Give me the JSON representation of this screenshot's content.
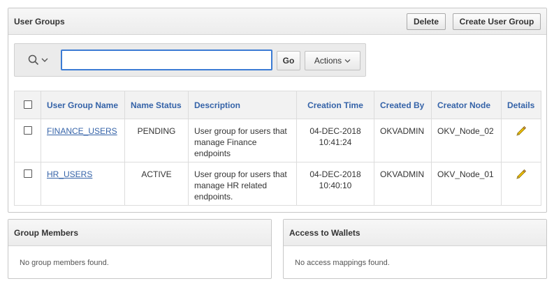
{
  "user_groups": {
    "title": "User Groups",
    "delete_label": "Delete",
    "create_label": "Create User Group",
    "search": {
      "value": "",
      "go_label": "Go",
      "actions_label": "Actions"
    },
    "columns": [
      "User Group Name",
      "Name Status",
      "Description",
      "Creation Time",
      "Created By",
      "Creator Node",
      "Details"
    ],
    "rows": [
      {
        "name": "FINANCE_USERS",
        "status": "PENDING",
        "description": "User group for users that manage Finance endpoints",
        "date": "04-DEC-2018",
        "time": "10:41:24",
        "created_by": "OKVADMIN",
        "creator_node": "OKV_Node_02"
      },
      {
        "name": "HR_USERS",
        "status": "ACTIVE",
        "description": "User group for users that manage HR related endpoints.",
        "date": "04-DEC-2018",
        "time": "10:40:10",
        "created_by": "OKVADMIN",
        "creator_node": "OKV_Node_01"
      }
    ]
  },
  "group_members": {
    "title": "Group Members",
    "empty_message": "No group members found."
  },
  "access_to_wallets": {
    "title": "Access to Wallets",
    "empty_message": "No access mappings found."
  },
  "colors": {
    "link": "#3563a8",
    "pending": "#e8a100",
    "active": "#2a8a2a",
    "focus": "#3b7bd4"
  }
}
